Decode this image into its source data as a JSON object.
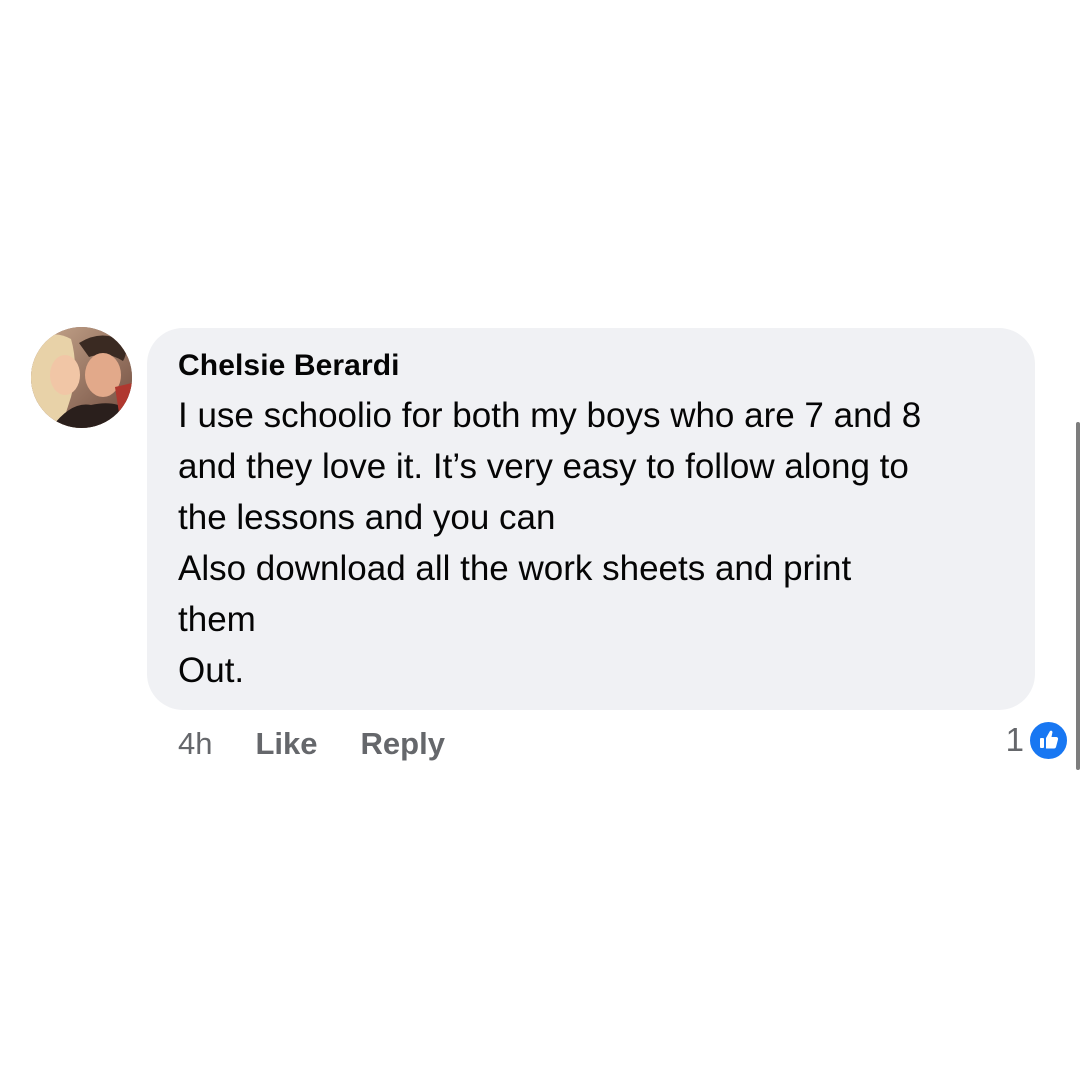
{
  "comment": {
    "author": "Chelsie Berardi",
    "avatar": "profile-photo",
    "lines": [
      "I use schoolio for both my boys who are 7 and 8",
      "and they love it. It’s very easy to follow along to",
      "the lessons and you can",
      "Also download all the work sheets and print",
      "them",
      "Out."
    ],
    "time": "4h",
    "like_label": "Like",
    "reply_label": "Reply",
    "reaction_count": "1",
    "reaction_icon": "thumbs-up-icon"
  },
  "colors": {
    "bubble": "#f0f1f4",
    "text": "#050505",
    "secondary": "#65676b",
    "like_blue": "#1877f2"
  }
}
